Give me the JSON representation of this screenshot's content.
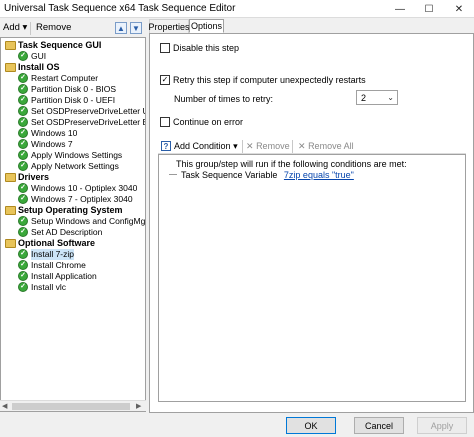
{
  "window": {
    "title": "Universal Task Sequence x64 Task Sequence Editor",
    "minimize": "—",
    "maximize": "☐",
    "close": "✕"
  },
  "toolbar": {
    "add": "Add",
    "add_arrow": "▾",
    "remove": "Remove"
  },
  "tree": [
    {
      "type": "group",
      "label": "Task Sequence GUI"
    },
    {
      "type": "step",
      "label": "GUI"
    },
    {
      "type": "group",
      "label": "Install OS"
    },
    {
      "type": "step",
      "label": "Restart Computer"
    },
    {
      "type": "step",
      "label": "Partition Disk 0 - BIOS"
    },
    {
      "type": "step",
      "label": "Partition Disk 0 - UEFI"
    },
    {
      "type": "step",
      "label": "Set OSDPreserveDriveLetter UEFI"
    },
    {
      "type": "step",
      "label": "Set OSDPreserveDriveLetter BIOS"
    },
    {
      "type": "step",
      "label": "Windows 10"
    },
    {
      "type": "step",
      "label": "Windows 7"
    },
    {
      "type": "step",
      "label": "Apply Windows Settings"
    },
    {
      "type": "step",
      "label": "Apply Network Settings"
    },
    {
      "type": "group",
      "label": "Drivers"
    },
    {
      "type": "step",
      "label": "Windows 10 - Optiplex 3040"
    },
    {
      "type": "step",
      "label": "Windows 7 - Optiplex 3040"
    },
    {
      "type": "group",
      "label": "Setup Operating System"
    },
    {
      "type": "step",
      "label": "Setup Windows and ConfigMgr"
    },
    {
      "type": "step",
      "label": "Set AD Description"
    },
    {
      "type": "group",
      "label": "Optional Software"
    },
    {
      "type": "step",
      "label": "Install 7-zip",
      "selected": true
    },
    {
      "type": "step",
      "label": "Install Chrome"
    },
    {
      "type": "step",
      "label": "Install Application"
    },
    {
      "type": "step",
      "label": "Install vlc"
    }
  ],
  "tabs": {
    "properties": "Properties",
    "options": "Options"
  },
  "options": {
    "disable_step": {
      "label": "Disable this step",
      "checked": false
    },
    "retry": {
      "label": "Retry this step if computer unexpectedly restarts",
      "checked": true
    },
    "retry_count_label": "Number of times to retry:",
    "retry_count_value": "2",
    "continue_on_error": {
      "label": "Continue on error",
      "checked": false
    }
  },
  "conditions": {
    "add_condition": "Add Condition",
    "remove": "Remove",
    "remove_all": "Remove All",
    "header": "This group/step will run if the following conditions are met:",
    "item_prefix": "Task Sequence Variable",
    "item_link": "7zip equals \"true\""
  },
  "buttons": {
    "ok": "OK",
    "cancel": "Cancel",
    "apply": "Apply"
  },
  "colors": {
    "folder": "#e8c45a",
    "check": "#3aa83a",
    "link": "#0645ad",
    "selection": "#cce4f7"
  }
}
